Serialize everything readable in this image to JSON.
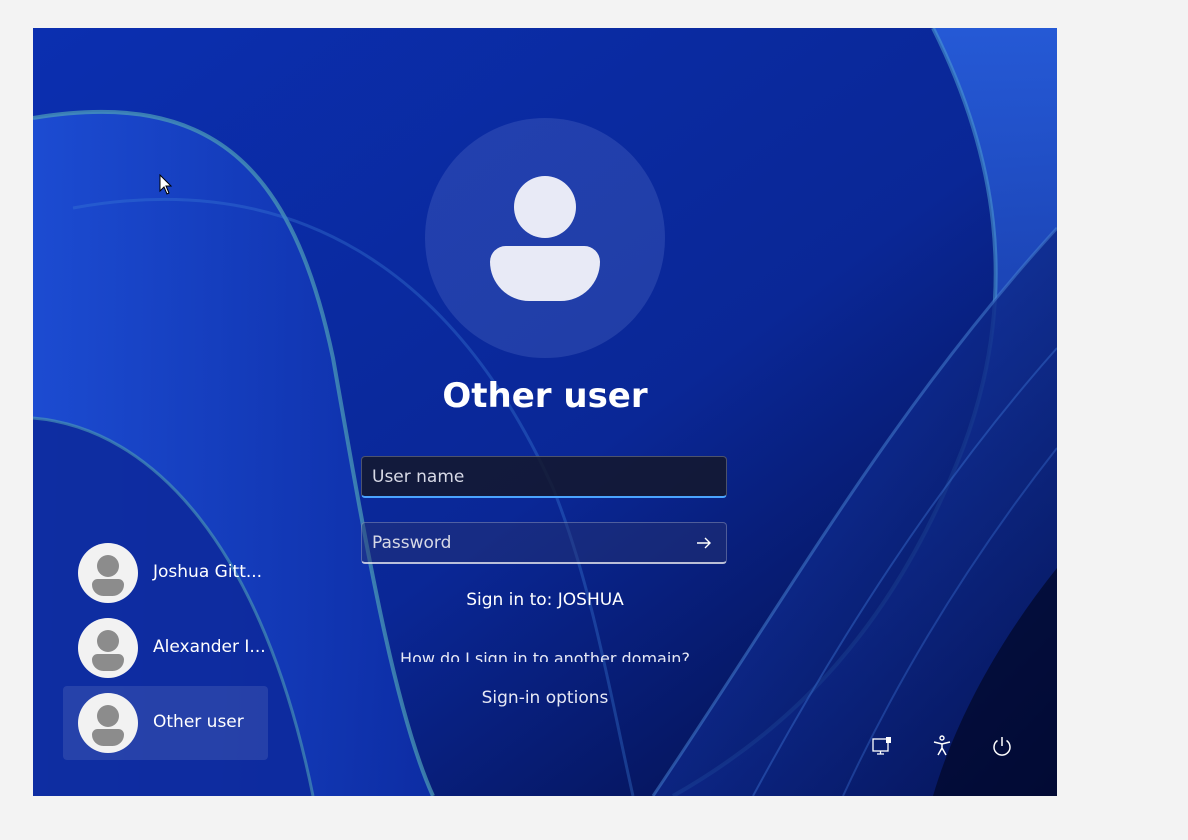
{
  "login": {
    "title": "Other user",
    "username_placeholder": "User name",
    "password_placeholder": "Password",
    "sign_in_to": "Sign in to: JOSHUA",
    "domain_help_link": "How do I sign in to another domain?",
    "sign_in_options": "Sign-in options"
  },
  "users": [
    {
      "name": "Joshua Gitt...",
      "selected": false
    },
    {
      "name": "Alexander I...",
      "selected": false
    },
    {
      "name": "Other user",
      "selected": true
    }
  ],
  "system_icons": [
    "network-icon",
    "accessibility-icon",
    "power-icon"
  ],
  "colors": {
    "accent": "#4aa3ff",
    "background": "#0a2a9e"
  }
}
